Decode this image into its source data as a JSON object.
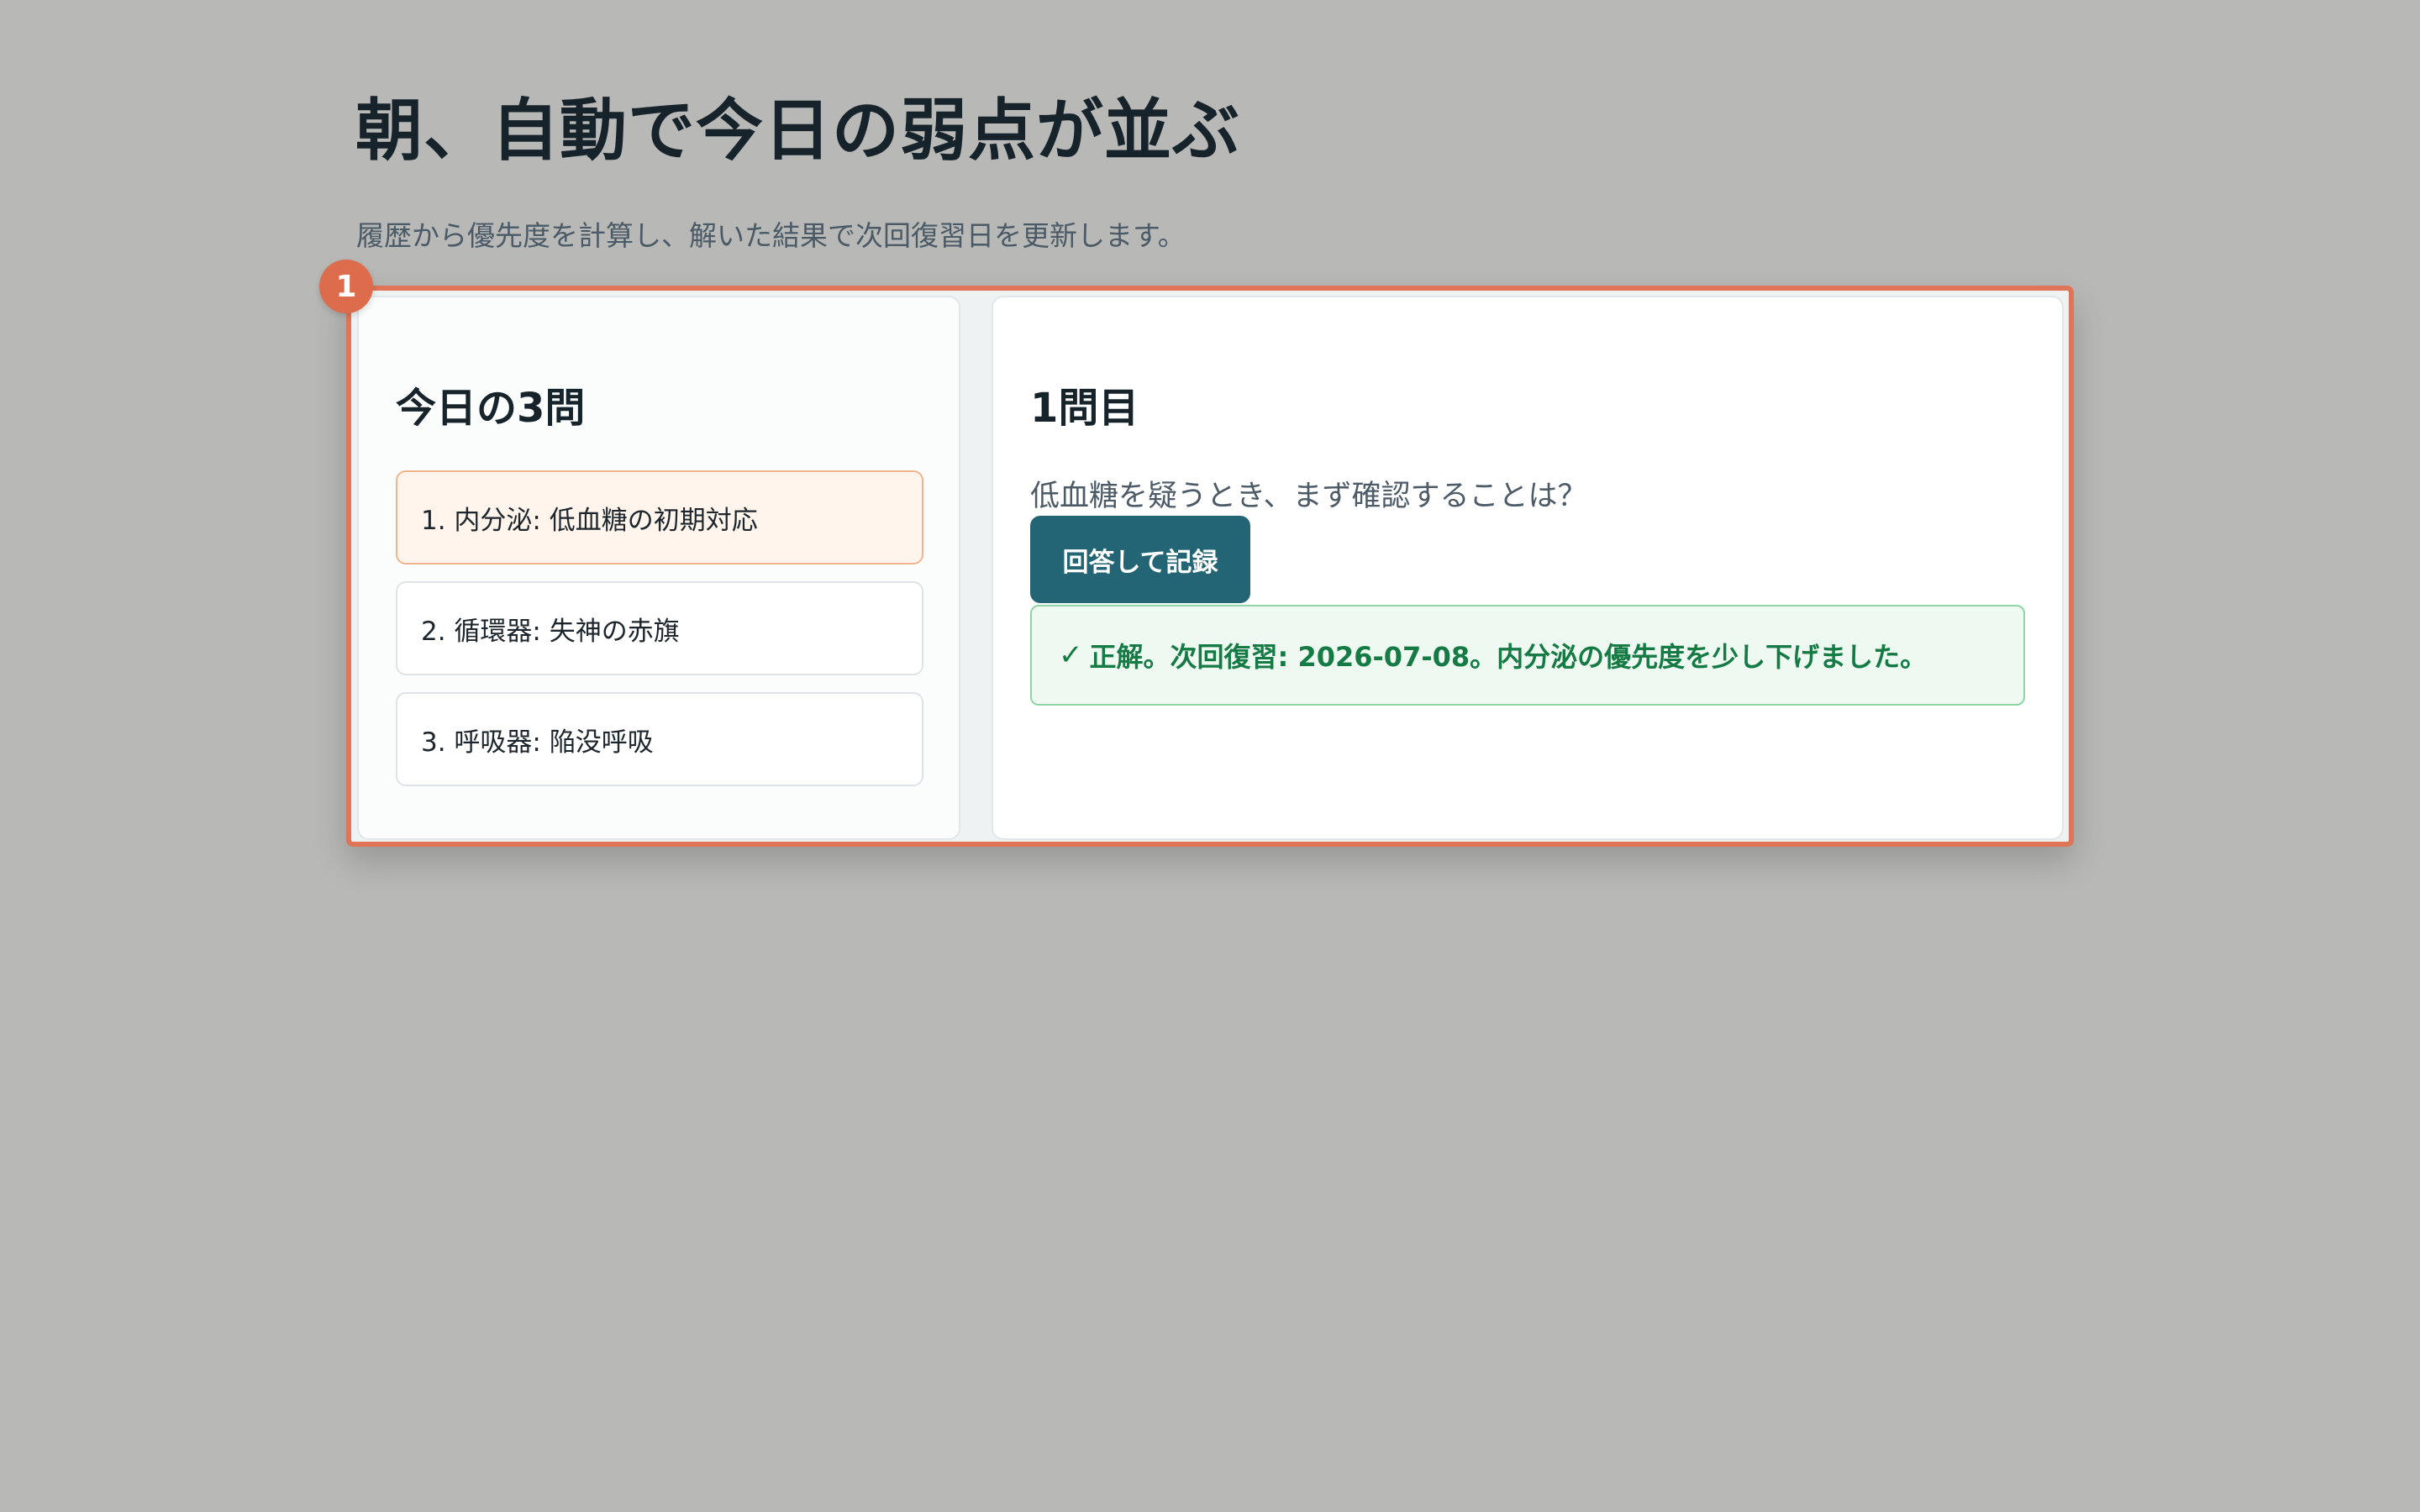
{
  "page": {
    "title": "朝、自動で今日の弱点が並ぶ",
    "subtitle": "履歴から優先度を計算し、解いた結果で次回復習日を更新します。"
  },
  "marker": {
    "label": "1"
  },
  "today_list": {
    "heading": "今日の3問",
    "items": [
      {
        "label": "1. 内分泌: 低血糖の初期対応",
        "active": true
      },
      {
        "label": "2. 循環器: 失神の赤旗",
        "active": false
      },
      {
        "label": "3. 呼吸器: 陥没呼吸",
        "active": false
      }
    ]
  },
  "question_panel": {
    "heading": "1問目",
    "question": "低血糖を疑うとき、まず確認することは？",
    "answer_button_label": "回答して記録",
    "result": {
      "icon": "✓",
      "text": "正解。次回復習: 2026-07-08。内分泌の優先度を少し下げました。"
    }
  },
  "colors": {
    "background": "#b8b8b6",
    "highlight_border": "#df7556",
    "primary_button": "#236574",
    "success_text": "#167a45",
    "success_bg": "#eefaf1",
    "active_item_bg": "#fff5ec"
  }
}
